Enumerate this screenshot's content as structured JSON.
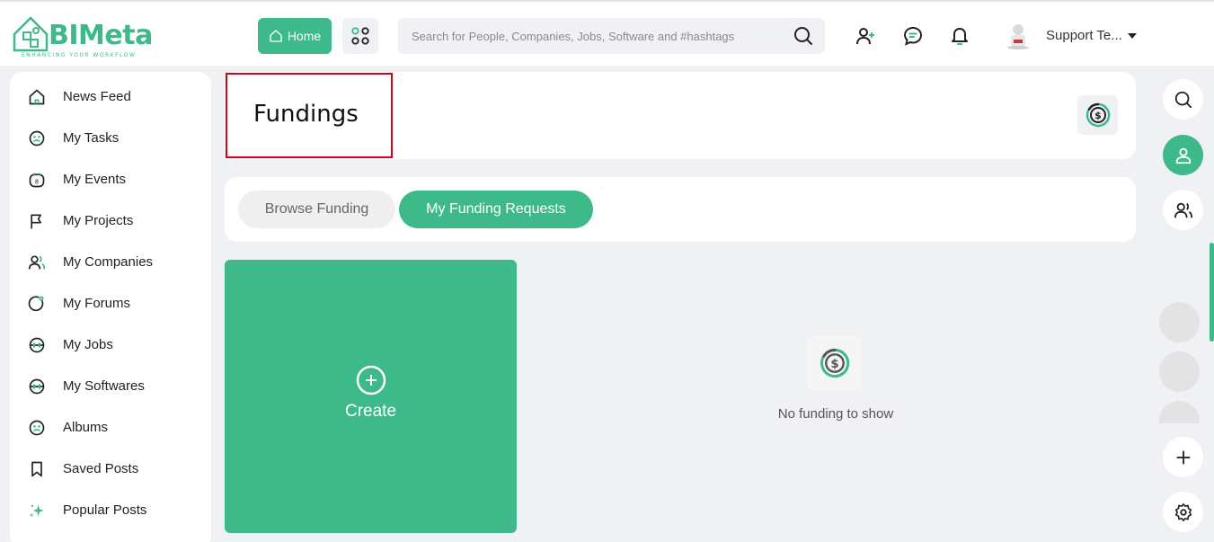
{
  "header": {
    "logo_text": "BIMeta",
    "logo_tagline": "ENHANCING YOUR WORKFLOW",
    "home_label": "Home",
    "search_placeholder": "Search for People, Companies, Jobs, Software and #hashtags",
    "user_name": "Support Te...",
    "icons": [
      "home-icon",
      "apps-grid-icon",
      "search-icon",
      "add-user-icon",
      "chat-icon",
      "bell-icon",
      "caret-down-icon"
    ]
  },
  "sidebar": {
    "items": [
      {
        "label": "News Feed",
        "icon": "home-icon"
      },
      {
        "label": "My Tasks",
        "icon": "tasks-icon"
      },
      {
        "label": "My Events",
        "icon": "calendar-icon"
      },
      {
        "label": "My Projects",
        "icon": "flag-icon"
      },
      {
        "label": "My Companies",
        "icon": "companies-icon"
      },
      {
        "label": "My Forums",
        "icon": "forum-icon"
      },
      {
        "label": "My Jobs",
        "icon": "jobs-icon"
      },
      {
        "label": "My Softwares",
        "icon": "software-icon"
      },
      {
        "label": "Albums",
        "icon": "albums-icon"
      },
      {
        "label": "Saved Posts",
        "icon": "bookmark-icon"
      },
      {
        "label": "Popular Posts",
        "icon": "sparkle-icon"
      }
    ]
  },
  "main": {
    "page_title": "Fundings",
    "tabs": [
      {
        "label": "Browse Funding",
        "active": false
      },
      {
        "label": "My Funding Requests",
        "active": true
      }
    ],
    "create_label": "Create",
    "empty_text": "No funding to show"
  },
  "rail": {
    "icons": [
      "search-icon",
      "user-icon",
      "users-icon",
      "plus-icon",
      "gear-icon"
    ]
  },
  "colors": {
    "accent": "#3db98a",
    "highlight_border": "#d0021b"
  }
}
